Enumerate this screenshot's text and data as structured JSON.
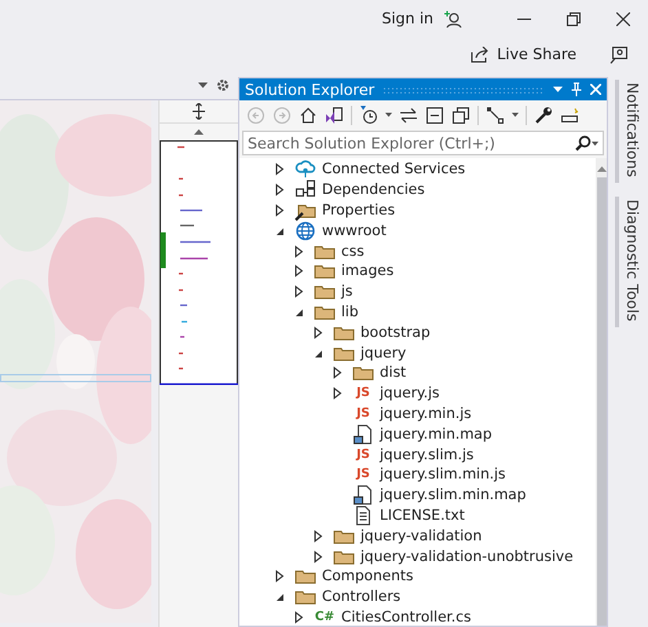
{
  "title_bar": {
    "sign_in": "Sign in"
  },
  "command_bar": {
    "live_share": "Live Share"
  },
  "solution_explorer": {
    "title": "Solution Explorer",
    "search": {
      "placeholder": "Search Solution Explorer (Ctrl+;)"
    },
    "tree": [
      {
        "label": "Connected Services",
        "kind": "connected",
        "expanded": false
      },
      {
        "label": "Dependencies",
        "kind": "deps",
        "expanded": false
      },
      {
        "label": "Properties",
        "kind": "properties",
        "expanded": false
      },
      {
        "label": "wwwroot",
        "kind": "globe",
        "expanded": true,
        "children": [
          {
            "label": "css",
            "kind": "folder",
            "expanded": false
          },
          {
            "label": "images",
            "kind": "folder",
            "expanded": false
          },
          {
            "label": "js",
            "kind": "folder",
            "expanded": false
          },
          {
            "label": "lib",
            "kind": "folder",
            "expanded": true,
            "children": [
              {
                "label": "bootstrap",
                "kind": "folder",
                "expanded": false
              },
              {
                "label": "jquery",
                "kind": "folder",
                "expanded": true,
                "children": [
                  {
                    "label": "dist",
                    "kind": "folder",
                    "expanded": false
                  },
                  {
                    "label": "jquery.js",
                    "kind": "script",
                    "badge": "JS",
                    "expanded": false
                  },
                  {
                    "label": "jquery.min.js",
                    "kind": "script",
                    "badge": "JS"
                  },
                  {
                    "label": "jquery.min.map",
                    "kind": "map"
                  },
                  {
                    "label": "jquery.slim.js",
                    "kind": "script",
                    "badge": "JS"
                  },
                  {
                    "label": "jquery.slim.min.js",
                    "kind": "script",
                    "badge": "JS"
                  },
                  {
                    "label": "jquery.slim.min.map",
                    "kind": "map"
                  },
                  {
                    "label": "LICENSE.txt",
                    "kind": "text"
                  }
                ]
              },
              {
                "label": "jquery-validation",
                "kind": "folder",
                "expanded": false
              },
              {
                "label": "jquery-validation-unobtrusive",
                "kind": "folder",
                "expanded": false
              }
            ]
          }
        ]
      },
      {
        "label": "Components",
        "kind": "folder",
        "expanded": false
      },
      {
        "label": "Controllers",
        "kind": "folder",
        "expanded": true,
        "children": [
          {
            "label": "CitiesController.cs",
            "kind": "csharp",
            "badge": "C#",
            "expanded": false
          }
        ]
      }
    ]
  },
  "side_tabs": [
    {
      "label": "Notifications"
    },
    {
      "label": "Diagnostic Tools"
    }
  ]
}
